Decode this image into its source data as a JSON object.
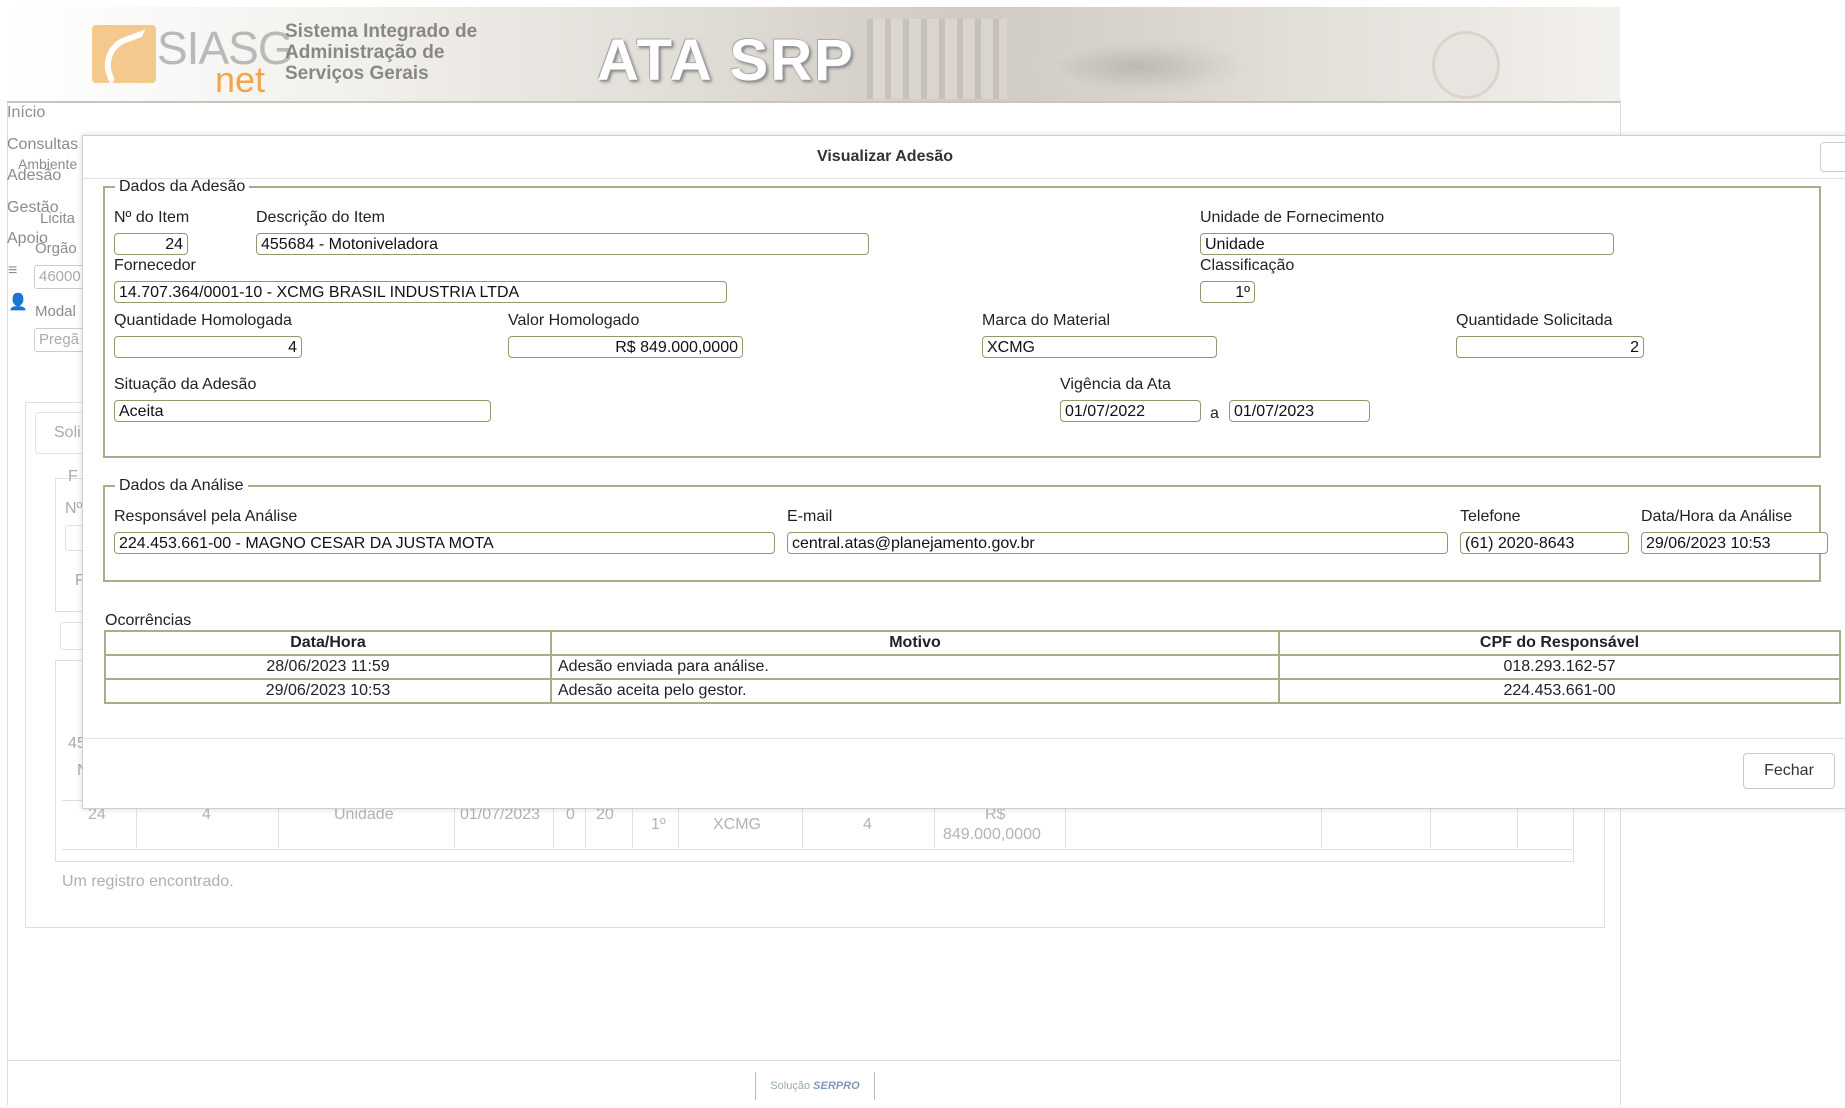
{
  "banner": {
    "logo_main": "SIASG",
    "logo_sub": "net",
    "line1": "Sistema Integrado de",
    "line2": "Administração de",
    "line3": "Serviços Gerais",
    "app_name": "ATA SRP"
  },
  "nav": {
    "inicio": "Início",
    "consultas": "Consultas",
    "ambiente": "Ambiente",
    "adesao": "Adesão",
    "gestao": "Gestão",
    "licita": "Licita",
    "apoio": "Apoio",
    "orgao": "Órgão",
    "orgao_value": "46000",
    "modal": "Modal",
    "modal_value": "Pregã",
    "menu_icon": "≡",
    "user_icon": "👤"
  },
  "background": {
    "tab_label": "Soli",
    "fieldset_f": "F",
    "fieldset_n": "Nº",
    "fieldset_f2": "F",
    "row_head_4": "45",
    "row_head_n": "N",
    "row": [
      "24",
      "4",
      "Unidade",
      "01/07/2023",
      "0",
      "20",
      "1º",
      "XCMG",
      "4",
      "R$",
      "849.000,0000"
    ],
    "footnote": "Um registro encontrado."
  },
  "footer": {
    "prefix": "Solução",
    "brand": "SERPRO"
  },
  "dialog": {
    "title": "Visualizar Adesão",
    "dados_adesao": {
      "legend": "Dados da Adesão",
      "item_no_label": "Nº do Item",
      "item_no": "24",
      "descricao_label": "Descrição do Item",
      "descricao": "455684 - Motoniveladora",
      "unidade_label": "Unidade de Fornecimento",
      "unidade": "Unidade",
      "fornecedor_label": "Fornecedor",
      "fornecedor": "14.707.364/0001-10 - XCMG BRASIL INDUSTRIA LTDA",
      "classificacao_label": "Classificação",
      "classificacao": "1º",
      "qtd_homologada_label": "Quantidade Homologada",
      "qtd_homologada": "4",
      "valor_homologado_label": "Valor Homologado",
      "valor_homologado": "R$ 849.000,0000",
      "marca_label": "Marca do Material",
      "marca": "XCMG",
      "qtd_solicitada_label": "Quantidade Solicitada",
      "qtd_solicitada": "2",
      "situacao_label": "Situação da Adesão",
      "situacao": "Aceita",
      "vigencia_label": "Vigência da Ata",
      "vigencia_inicio": "01/07/2022",
      "vigencia_sep": "a",
      "vigencia_fim": "01/07/2023"
    },
    "dados_analise": {
      "legend": "Dados da Análise",
      "responsavel_label": "Responsável pela Análise",
      "responsavel": "224.453.661-00 - MAGNO CESAR DA JUSTA MOTA",
      "email_label": "E-mail",
      "email": "central.atas@planejamento.gov.br",
      "telefone_label": "Telefone",
      "telefone": "(61) 2020-8643",
      "datahora_label": "Data/Hora da Análise",
      "datahora": "29/06/2023 10:53"
    },
    "ocorrencias": {
      "label": "Ocorrências",
      "columns": [
        "Data/Hora",
        "Motivo",
        "CPF do Responsável"
      ],
      "rows": [
        [
          "28/06/2023 11:59",
          "Adesão enviada para análise.",
          "018.293.162-57"
        ],
        [
          "29/06/2023 10:53",
          "Adesão aceita pelo gestor.",
          "224.453.661-00"
        ]
      ]
    },
    "close_button": "Fechar"
  }
}
